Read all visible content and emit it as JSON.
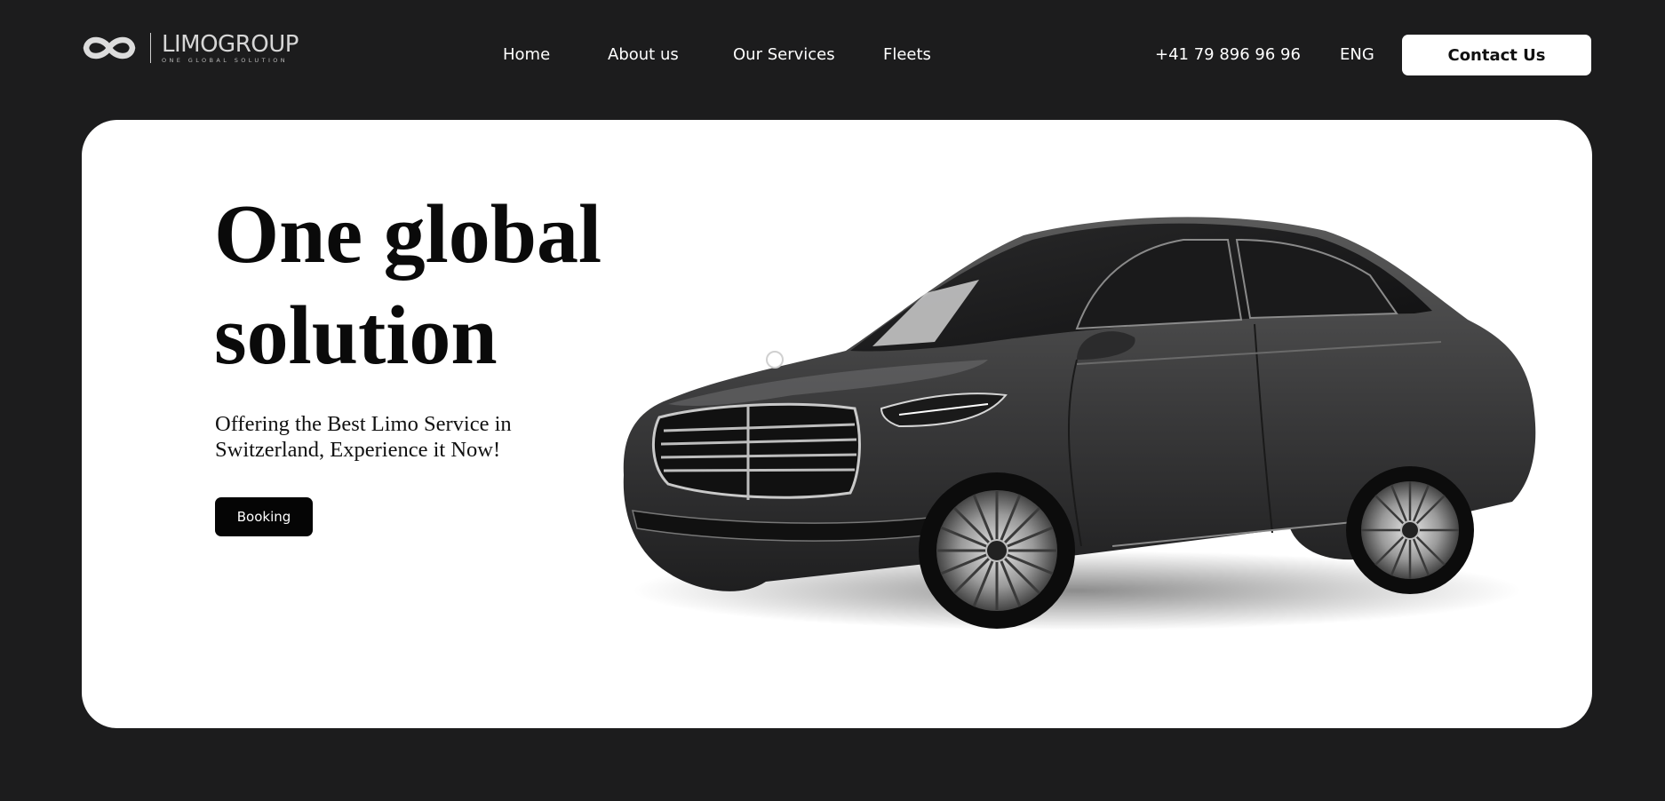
{
  "brand": {
    "name": "LIMOGROUP",
    "tagline": "ONE GLOBAL SOLUTION"
  },
  "nav": {
    "items": [
      {
        "label": "Home"
      },
      {
        "label": "About us"
      },
      {
        "label": "Our Services"
      },
      {
        "label": "Fleets"
      }
    ]
  },
  "header": {
    "phone": "+41 79 896 96 96",
    "language": "ENG",
    "contact_label": "Contact Us"
  },
  "hero": {
    "title_line1": "One global",
    "title_line2": "solution",
    "subtitle_line1": "Offering the Best Limo Service in",
    "subtitle_line2": "Switzerland, Experience it Now!",
    "booking_label": "Booking",
    "image": "black-luxury-sedan-photo"
  },
  "colors": {
    "page_background": "#1c1c1d",
    "card_background": "#ffffff",
    "primary_dark": "#050505",
    "nav_text": "#ffffff"
  }
}
